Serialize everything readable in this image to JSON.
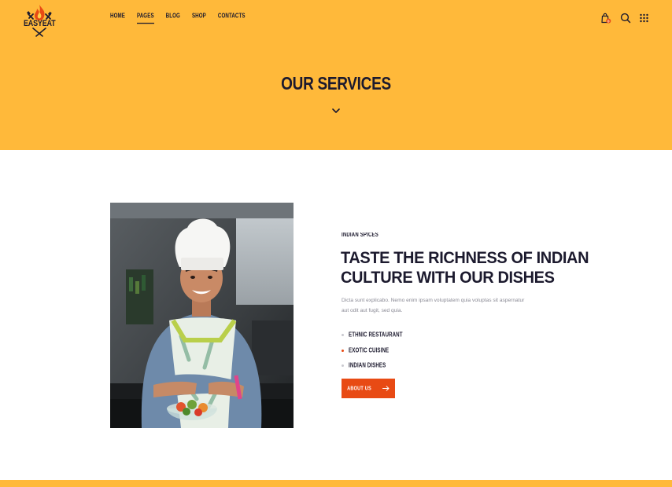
{
  "brand": {
    "name": "EASYEAT"
  },
  "nav": {
    "items": [
      {
        "label": "HOME"
      },
      {
        "label": "PAGES"
      },
      {
        "label": "BLOG"
      },
      {
        "label": "SHOP"
      },
      {
        "label": "CONTACTS"
      }
    ],
    "active_index": 1
  },
  "header_icons": [
    "shopping-bag-icon",
    "search-icon",
    "grid-menu-icon"
  ],
  "cart": {
    "count": "0"
  },
  "hero": {
    "title": "OUR SERVICES"
  },
  "section": {
    "subtitle": "INDIAN SPICES",
    "heading_line1": "TASTE THE RICHNESS OF INDIAN",
    "heading_line2": "CULTURE WITH OUR DISHES",
    "description": "Dicta sunt explicabo. Nemo enim ipsam voluptatem quia voluptas sit aspernatur aut odit aut fugit, sed quia.",
    "features": [
      {
        "label": "ETHNIC RESTAURANT",
        "bullet_color": "#c9c9cf"
      },
      {
        "label": "EXOTIC CUISINE",
        "bullet_color": "#e84a14"
      },
      {
        "label": "INDIAN DISHES",
        "bullet_color": "#c9c9cf"
      }
    ],
    "button_label": "ABOUT US"
  },
  "colors": {
    "accent_yellow": "#ffb93a",
    "accent_red": "#e84a14",
    "text_dark": "#1c1a2e"
  }
}
